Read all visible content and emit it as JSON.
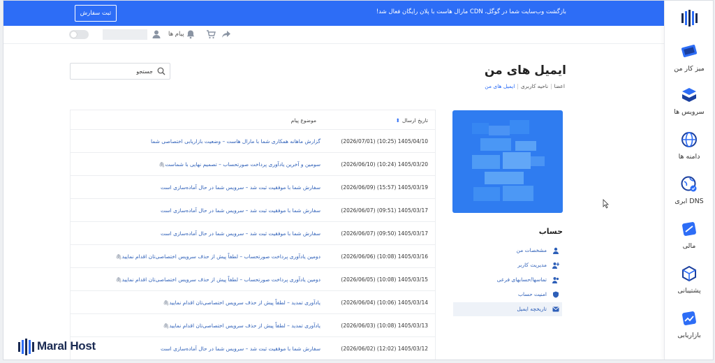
{
  "banner": {
    "text": "بازگشت وب‌سایت شما در گوگل، CDN مارال هاست با پلان رایگان فعال شد!",
    "button_label": "ثبت سفارش",
    "color": "#2d6df6"
  },
  "toolbar": {
    "messages_label": "پیام ها",
    "toggle_label": "OFF"
  },
  "sidebar": {
    "items": [
      {
        "label": "میز کار من",
        "icon": "desktop-icon"
      },
      {
        "label": "سرویس ها",
        "icon": "services-icon"
      },
      {
        "label": "دامنه ها",
        "icon": "domain-icon"
      },
      {
        "label": "DNS ابری",
        "icon": "cloud-dns-icon"
      },
      {
        "label": "مالی",
        "icon": "finance-icon"
      },
      {
        "label": "پشتیبانی",
        "icon": "support-icon"
      },
      {
        "label": "بازاریابی",
        "icon": "marketing-icon"
      }
    ]
  },
  "page": {
    "title": "ایمیل های من",
    "breadcrumb": [
      "اعضا",
      "ناحیه کاربری",
      "ایمیل های من"
    ]
  },
  "search": {
    "placeholder": "جستجو"
  },
  "account": {
    "title": "حساب",
    "items": [
      {
        "label": "مشخصات من",
        "icon": "user-icon"
      },
      {
        "label": "مدیریت کاربر",
        "icon": "user-manage-icon"
      },
      {
        "label": "تماسها/حسابهای فرعی",
        "icon": "contacts-icon"
      },
      {
        "label": "امنیت حساب",
        "icon": "shield-icon"
      },
      {
        "label": "تاریخچه ایمیل",
        "icon": "mail-icon",
        "active": true
      }
    ]
  },
  "table": {
    "headers": {
      "date": "تاریخ ارسال",
      "subject": "موضوع پیام"
    },
    "rows": [
      {
        "date": "1405/04/10 (10:25) (2026/07/01)",
        "subject": "گزارش ماهانه همکاری شما با مارال هاست – وضعیت بازاریابی اختصاصی شما",
        "attachment": false
      },
      {
        "date": "1405/03/20 (10:24) (2026/06/10)",
        "subject": "سومین و آخرین یادآوری پرداخت صورتحساب – تصمیم نهایی با شماست",
        "attachment": true
      },
      {
        "date": "1405/03/19 (15:57) (2026/06/09)",
        "subject": "سفارش شما با موفقیت ثبت شد – سرویس شما در حال آماده‌سازی است",
        "attachment": false
      },
      {
        "date": "1405/03/17 (09:51) (2026/06/07)",
        "subject": "سفارش شما با موفقیت ثبت شد – سرویس شما در حال آماده‌سازی است",
        "attachment": false
      },
      {
        "date": "1405/03/17 (09:50) (2026/06/07)",
        "subject": "سفارش شما با موفقیت ثبت شد – سرویس شما در حال آماده‌سازی است",
        "attachment": false
      },
      {
        "date": "1405/03/16 (10:08) (2026/06/06)",
        "subject": "دومین یادآوری پرداخت صورتحساب – لطفاً پیش از حذف سرویس اختصاصی‌تان اقدام نمایید",
        "attachment": true
      },
      {
        "date": "1405/03/15 (10:08) (2026/06/05)",
        "subject": "دومین یادآوری پرداخت صورتحساب – لطفاً پیش از حذف سرویس اختصاصی‌تان اقدام نمایید",
        "attachment": true
      },
      {
        "date": "1405/03/14 (10:06) (2026/06/04)",
        "subject": "یادآوری تمدید – لطفاً پیش از حذف سرویس اختصاصی‌تان اقدام نمایید",
        "attachment": true
      },
      {
        "date": "1405/03/13 (10:08) (2026/06/03)",
        "subject": "یادآوری تمدید – لطفاً پیش از حذف سرویس اختصاصی‌تان اقدام نمایید",
        "attachment": true
      },
      {
        "date": "1405/03/12 (12:02) (2026/06/02)",
        "subject": "سفارش شما با موفقیت ثبت شد – سرویس شما در حال آماده‌سازی است",
        "attachment": false
      }
    ]
  },
  "watermark": {
    "text": "Maral Host"
  }
}
